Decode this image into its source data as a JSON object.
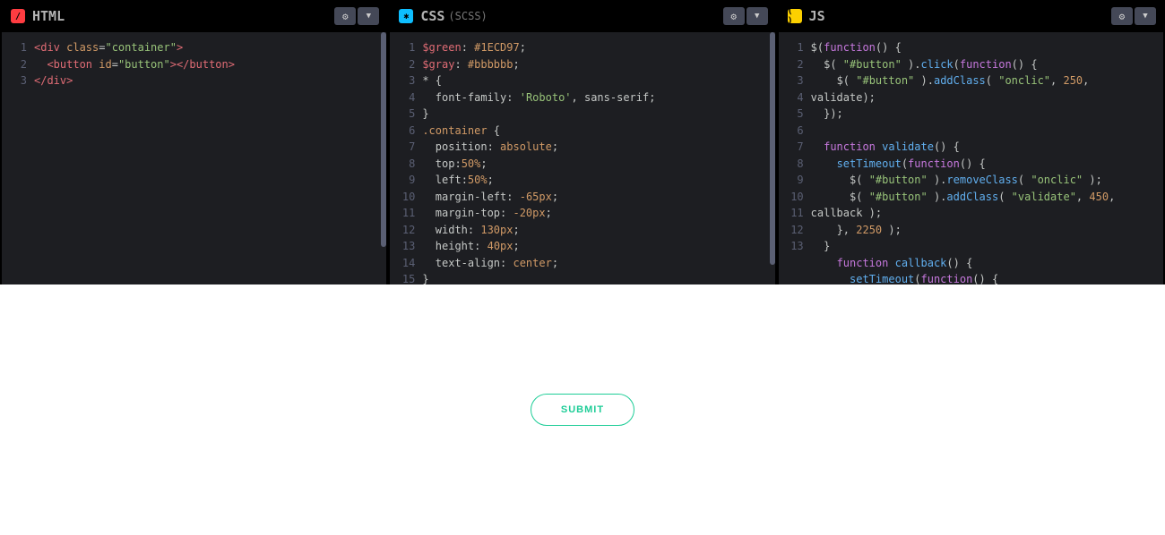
{
  "panels": {
    "html": {
      "label": "HTML",
      "icon_bg": "#FF3C41",
      "lines": [
        "1",
        "2",
        "3"
      ]
    },
    "css": {
      "label": "CSS",
      "sub": "(SCSS)",
      "icon_bg": "#0EBEFF",
      "lines": [
        "1",
        "2",
        "3",
        "4",
        "5",
        "6",
        "7",
        "8",
        "9",
        "10",
        "11",
        "12",
        "13",
        "14",
        "15"
      ]
    },
    "js": {
      "label": "JS",
      "icon_bg": "#FCD000",
      "lines": [
        "1",
        "2",
        "3",
        "4",
        "5",
        "6",
        "7",
        "8",
        "9",
        "10",
        "11",
        "12",
        "13"
      ]
    }
  },
  "html_code": {
    "l1_open": "<div ",
    "l1_attr1": "class",
    "l1_eq": "=",
    "l1_val1": "\"container\"",
    "l1_close": ">",
    "l2_indent": "  ",
    "l2_open": "<button ",
    "l2_attr": "id",
    "l2_eq": "=",
    "l2_val": "\"button\"",
    "l2_close": "></button>",
    "l3": "</div>"
  },
  "css_code": {
    "l1_var": "$green",
    "l1_c": ": ",
    "l1_val": "#1ECD97",
    "l1_s": ";",
    "l2_var": "$gray",
    "l2_c": ": ",
    "l2_val": "#bbbbbb",
    "l2_s": ";",
    "l3": "* {",
    "l4_i": "  ",
    "l4_p": "font-family",
    "l4_c": ": ",
    "l4_v": "'Roboto'",
    "l4_r": ", sans-serif;",
    "l5": "}",
    "l6_sel": ".container",
    "l6_b": " {",
    "l7_i": "  ",
    "l7_p": "position",
    "l7_c": ": ",
    "l7_v": "absolute",
    "l7_s": ";",
    "l8_i": "  ",
    "l8_p": "top",
    "l8_c": ":",
    "l8_v": "50%",
    "l8_s": ";",
    "l9_i": "  ",
    "l9_p": "left",
    "l9_c": ":",
    "l9_v": "50%",
    "l9_s": ";",
    "l10_i": "  ",
    "l10_p": "margin-left",
    "l10_c": ": ",
    "l10_v": "-65px",
    "l10_s": ";",
    "l11_i": "  ",
    "l11_p": "margin-top",
    "l11_c": ": ",
    "l11_v": "-20px",
    "l11_s": ";",
    "l12_i": "  ",
    "l12_p": "width",
    "l12_c": ": ",
    "l12_v": "130px",
    "l12_s": ";",
    "l13_i": "  ",
    "l13_p": "height",
    "l13_c": ": ",
    "l13_v": "40px",
    "l13_s": ";",
    "l14_i": "  ",
    "l14_p": "text-align",
    "l14_c": ": ",
    "l14_v": "center",
    "l14_s": ";",
    "l15": "}"
  },
  "js_code": {
    "l1_a": "$(",
    "l1_kw": "function",
    "l1_b": "() {",
    "l2_i": "  ",
    "l2_a": "$( ",
    "l2_s": "\"#button\"",
    "l2_b": " ).",
    "l2_fn": "click",
    "l2_c": "(",
    "l2_kw": "function",
    "l2_d": "() {",
    "l3_i": "    ",
    "l3_a": "$( ",
    "l3_s": "\"#button\"",
    "l3_b": " ).",
    "l3_fn": "addClass",
    "l3_c": "( ",
    "l3_s2": "\"onclic\"",
    "l3_d": ", ",
    "l3_n": "250",
    "l3_e": ",",
    "l3b_i": "",
    "l3b_a": "validate);",
    "l4_i": "  ",
    "l4_a": "});",
    "l5": "",
    "l6_i": "  ",
    "l6_kw": "function",
    "l6_sp": " ",
    "l6_fn": "validate",
    "l6_b": "() {",
    "l7_i": "    ",
    "l7_fn": "setTimeout",
    "l7_a": "(",
    "l7_kw": "function",
    "l7_b": "() {",
    "l8_i": "      ",
    "l8_a": "$( ",
    "l8_s": "\"#button\"",
    "l8_b": " ).",
    "l8_fn": "removeClass",
    "l8_c": "( ",
    "l8_s2": "\"onclic\"",
    "l8_d": " );",
    "l9_i": "      ",
    "l9_a": "$( ",
    "l9_s": "\"#button\"",
    "l9_b": " ).",
    "l9_fn": "addClass",
    "l9_c": "( ",
    "l9_s2": "\"validate\"",
    "l9_d": ", ",
    "l9_n": "450",
    "l9_e": ",",
    "l9b_i": "",
    "l9b_a": "callback );",
    "l10_i": "    ",
    "l10_a": "}, ",
    "l10_n": "2250",
    "l10_b": " );",
    "l11_i": "  ",
    "l11_a": "}",
    "l12_i": "    ",
    "l12_kw": "function",
    "l12_sp": " ",
    "l12_fn": "callback",
    "l12_b": "() {",
    "l13_i": "      ",
    "l13_fn": "setTimeout",
    "l13_a": "(",
    "l13_kw": "function",
    "l13_b": "() {"
  },
  "preview": {
    "button_label": "SUBMIT",
    "green": "#1ECD97"
  }
}
